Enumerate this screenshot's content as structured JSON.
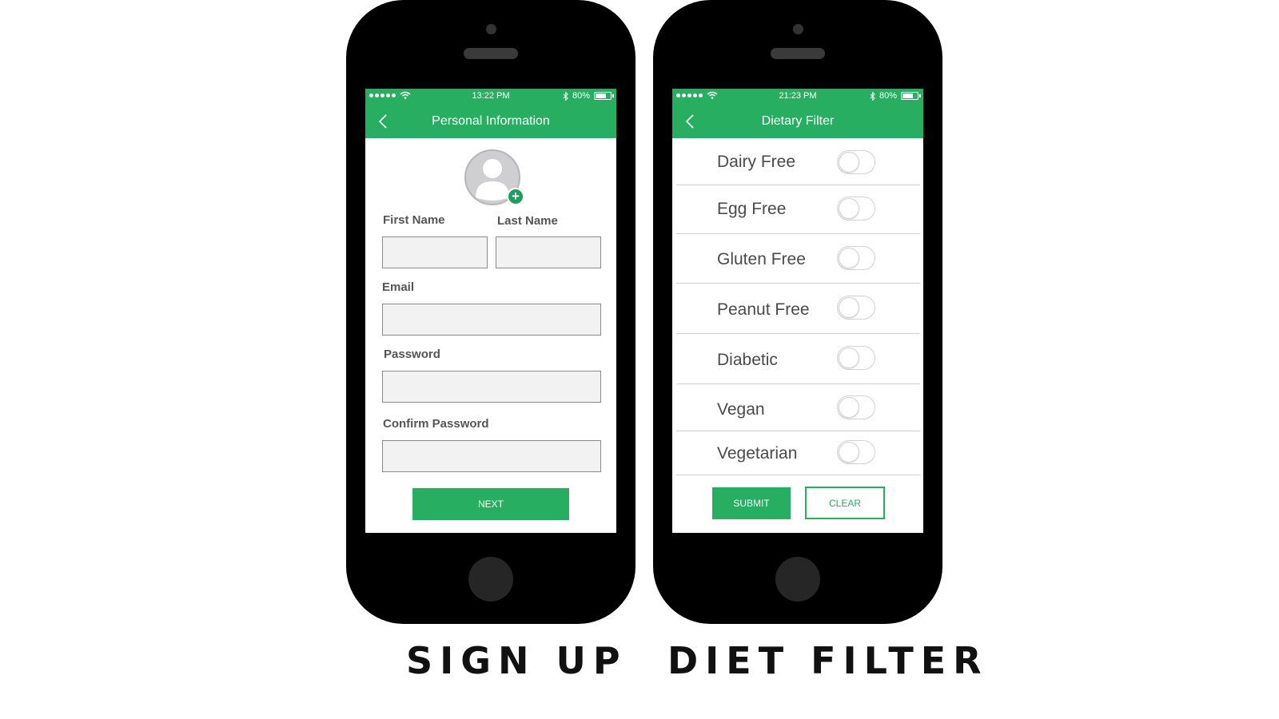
{
  "theme": {
    "primary": "#27ae60",
    "device": "#000000"
  },
  "signup_screen": {
    "status": {
      "time": "13:22 PM",
      "battery": "80%"
    },
    "nav_title": "Personal Information",
    "first_name_label": "First Name",
    "last_name_label": "Last Name",
    "email_label": "Email",
    "password_label": "Password",
    "confirm_password_label": "Confirm Password",
    "next_label": "NEXT",
    "caption": "SIGN UP"
  },
  "diet_screen": {
    "status": {
      "time": "21:23 PM",
      "battery": "80%"
    },
    "nav_title": "Dietary Filter",
    "filters": [
      {
        "label": "Dairy Free",
        "on": false
      },
      {
        "label": "Egg Free",
        "on": false
      },
      {
        "label": "Gluten Free",
        "on": false
      },
      {
        "label": "Peanut Free",
        "on": false
      },
      {
        "label": "Diabetic",
        "on": false
      },
      {
        "label": "Vegan",
        "on": false
      },
      {
        "label": "Vegetarian",
        "on": false
      }
    ],
    "submit_label": "SUBMIT",
    "clear_label": "CLEAR",
    "caption": "DIET FILTER"
  }
}
